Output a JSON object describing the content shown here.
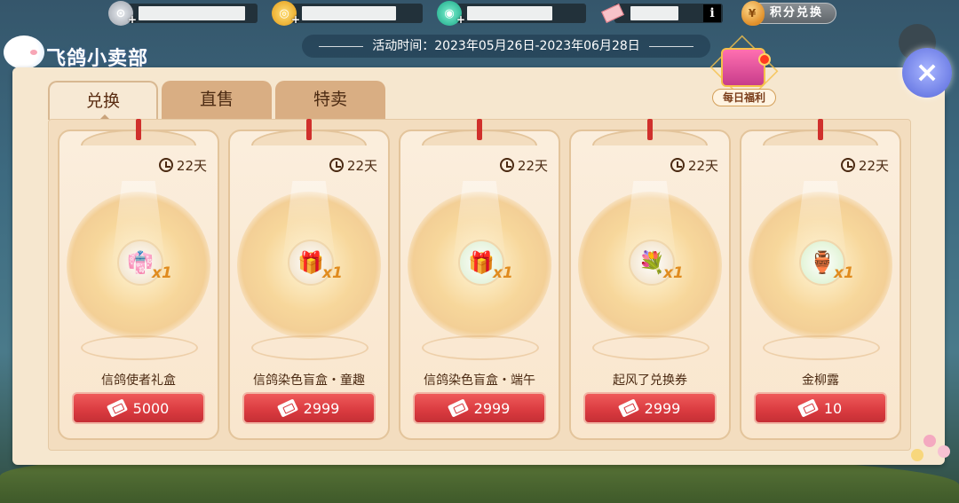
{
  "topbar": {
    "resources": [
      {
        "icon": "silver-coin-icon",
        "color": "#b7bcc5"
      },
      {
        "icon": "gold-coin-icon",
        "color": "#f0b321"
      },
      {
        "icon": "jade-icon",
        "color": "#1fbf9a"
      },
      {
        "icon": "ticket-icon",
        "color": "#f4a9b0"
      }
    ],
    "points_exchange_label": "积分兑换"
  },
  "header": {
    "shop_title": "飞鸽小卖部",
    "event_time": "活动时间：2023年05月26日-2023年06月28日",
    "daily_welfare_label": "每日福利"
  },
  "tabs": [
    {
      "label": "兑换",
      "active": true
    },
    {
      "label": "直售",
      "active": false
    },
    {
      "label": "特卖",
      "active": false
    }
  ],
  "items": [
    {
      "name": "信鸽使者礼盒",
      "time_left": "22天",
      "quantity": "x1",
      "price": "5000",
      "icon": "outfit-icon"
    },
    {
      "name": "信鸽染色盲盒・童趣",
      "time_left": "22天",
      "quantity": "x1",
      "price": "2999",
      "icon": "pink-gift-box-icon"
    },
    {
      "name": "信鸽染色盲盒・端午",
      "time_left": "22天",
      "quantity": "x1",
      "price": "2999",
      "icon": "green-gift-box-icon"
    },
    {
      "name": "起风了兑换券",
      "time_left": "22天",
      "quantity": "x1",
      "price": "2999",
      "icon": "flower-wreath-icon"
    },
    {
      "name": "金柳露",
      "time_left": "22天",
      "quantity": "x1",
      "price": "10",
      "icon": "green-vase-icon"
    }
  ],
  "colors": {
    "panel": "#f6e7cf",
    "price_button": "#d93a3f",
    "accent_text": "#4b2a12"
  }
}
